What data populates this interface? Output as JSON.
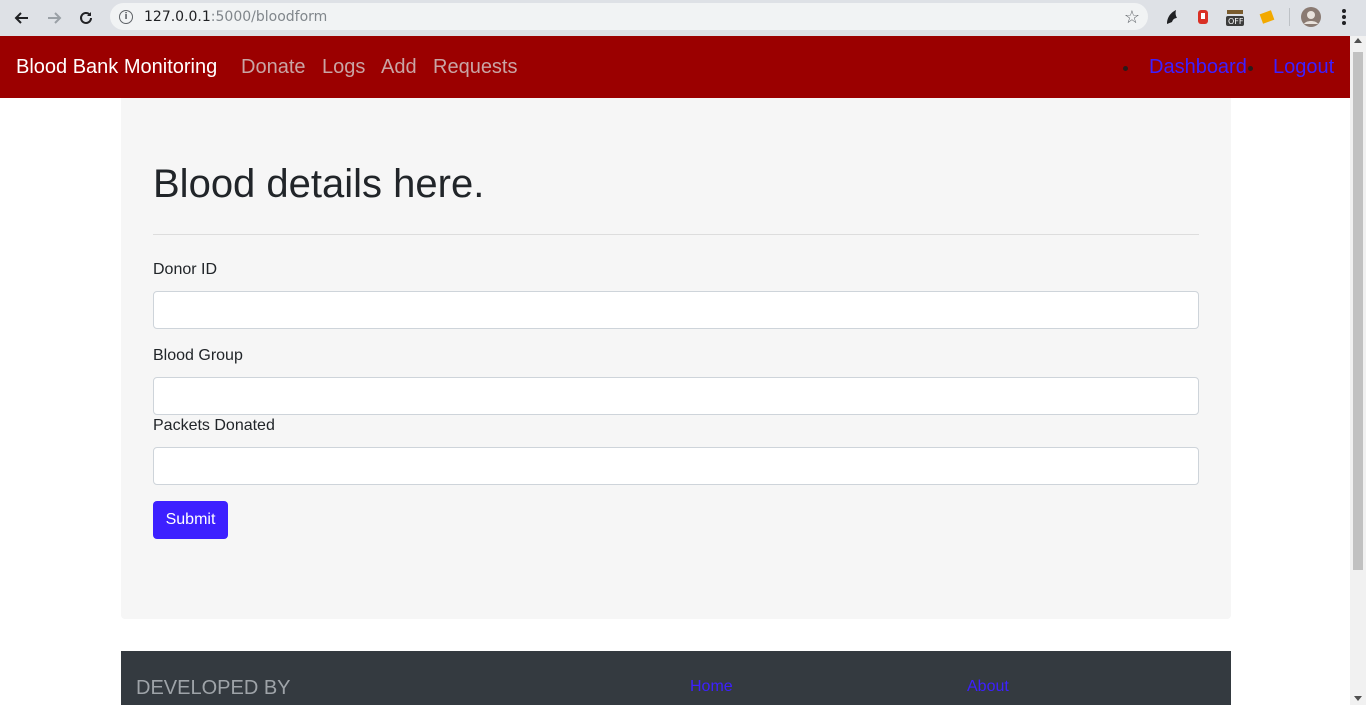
{
  "browser": {
    "url_host": "127.0.0.1",
    "url_rest": ":5000/bloodform"
  },
  "navbar": {
    "brand": "Blood Bank Monitoring",
    "links": [
      "Donate",
      "Logs",
      "Add",
      "Requests"
    ],
    "right_links": [
      "Dashboard",
      "Logout"
    ]
  },
  "form": {
    "heading": "Blood details here.",
    "fields": [
      {
        "label": "Donor ID",
        "value": ""
      },
      {
        "label": "Blood Group",
        "value": ""
      },
      {
        "label": "Packets Donated",
        "value": ""
      }
    ],
    "submit_label": "Submit"
  },
  "footer": {
    "developed_by": "DEVELOPED BY",
    "links": [
      "Home",
      "About"
    ]
  },
  "colors": {
    "navbar": "#9b0000",
    "accent": "#3d20ff",
    "footer": "#343a40",
    "jumbotron": "#f6f6f6"
  },
  "icons": [
    "back-arrow-icon",
    "forward-arrow-icon",
    "reload-icon",
    "info-icon",
    "bookmark-star-icon",
    "profile-avatar-icon",
    "menu-dots-icon"
  ]
}
